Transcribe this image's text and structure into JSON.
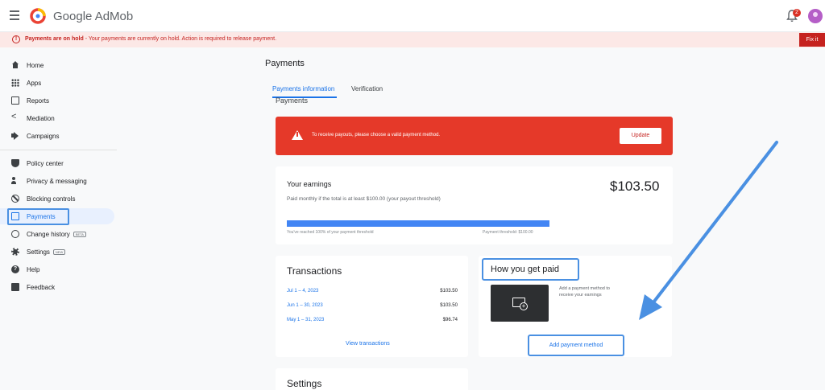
{
  "header": {
    "brand": "Google AdMob",
    "notification_count": "2"
  },
  "banner": {
    "title": "Payments are on hold",
    "message": " - Your payments are currently on hold. Action is required to release payment.",
    "action": "Fix it"
  },
  "sidebar": {
    "items": [
      {
        "label": "Home"
      },
      {
        "label": "Apps"
      },
      {
        "label": "Reports"
      },
      {
        "label": "Mediation"
      },
      {
        "label": "Campaigns"
      },
      {
        "label": "Policy center"
      },
      {
        "label": "Privacy & messaging"
      },
      {
        "label": "Blocking controls"
      },
      {
        "label": "Payments"
      },
      {
        "label": "Change history",
        "badge": "BETA"
      },
      {
        "label": "Settings",
        "badge": "NEW"
      },
      {
        "label": "Help"
      },
      {
        "label": "Feedback"
      }
    ]
  },
  "main": {
    "title": "Payments",
    "tabs": [
      {
        "label": "Payments information"
      },
      {
        "label": "Verification"
      }
    ],
    "subheading": "Payments",
    "error": {
      "message": "To receive payouts, please choose a valid payment method.",
      "action": "Update"
    },
    "earnings": {
      "title": "Your earnings",
      "amount": "$103.50",
      "subtitle": "Paid monthly if the total is at least $100.00 (your payout threshold)",
      "progress_fraction": 1.0,
      "progress_left": "You've reached 100% of your payment threshold",
      "progress_right": "Payment threshold: $100.00"
    },
    "transactions": {
      "title": "Transactions",
      "rows": [
        {
          "date": "Jul 1 – 4, 2023",
          "amount": "$103.50"
        },
        {
          "date": "Jun 1 – 30, 2023",
          "amount": "$103.50"
        },
        {
          "date": "May 1 – 31, 2023",
          "amount": "$96.74"
        }
      ],
      "link": "View transactions"
    },
    "how_paid": {
      "title": "How you get paid",
      "description": "Add a payment method to receive your earnings",
      "button": "Add payment method"
    },
    "settings": {
      "title": "Settings"
    }
  },
  "colors": {
    "accent": "#1a73e8",
    "error": "#e53929",
    "annotation": "#4a90e2"
  }
}
